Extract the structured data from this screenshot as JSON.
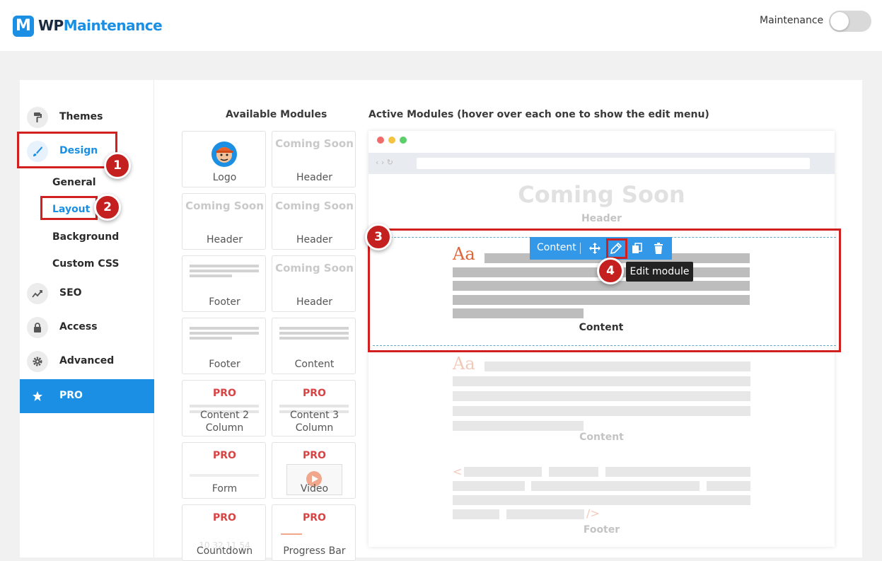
{
  "header": {
    "logo_letter": "M",
    "logo_wp": "WP",
    "logo_main": "Maintenance",
    "maintenance_label": "Maintenance",
    "maintenance_on": false
  },
  "sidebar": {
    "items": [
      {
        "label": "Themes",
        "icon": "paint-roller-icon"
      },
      {
        "label": "Design",
        "icon": "brush-icon"
      },
      {
        "label": "SEO",
        "icon": "chart-line-icon"
      },
      {
        "label": "Access",
        "icon": "lock-icon"
      },
      {
        "label": "Advanced",
        "icon": "gear-icon"
      },
      {
        "label": "PRO",
        "icon": "star-icon"
      }
    ],
    "design_subitems": [
      "General",
      "Layout",
      "Background",
      "Custom CSS"
    ]
  },
  "annotations": [
    "1",
    "2",
    "3",
    "4"
  ],
  "available_modules": {
    "title": "Available Modules",
    "coming_soon_text": "Coming Soon",
    "pro_tag": "PRO",
    "tiles": [
      {
        "label": "Logo"
      },
      {
        "label": "Header"
      },
      {
        "label": "Header"
      },
      {
        "label": "Header"
      },
      {
        "label": "Footer"
      },
      {
        "label": "Header"
      },
      {
        "label": "Footer"
      },
      {
        "label": "Content"
      },
      {
        "label": "Content 2 Column"
      },
      {
        "label": "Content 3 Column"
      },
      {
        "label": "Form"
      },
      {
        "label": "Video"
      },
      {
        "label": "Countdown"
      },
      {
        "label": "Progress Bar"
      }
    ],
    "countdown_digits": "10 32 11 54"
  },
  "active_modules": {
    "title": "Active Modules (hover over each one to show the edit menu)",
    "header_preview_text": "Coming Soon",
    "header_label": "Header",
    "content_aa": "Aa",
    "content_label": "Content",
    "content2_label": "Content",
    "footer_label": "Footer",
    "footer_lt": "<",
    "footer_slash": "/>",
    "toolbar": {
      "label": "Content",
      "icons": [
        "move-icon",
        "pencil-icon",
        "copy-icon",
        "trash-icon"
      ]
    },
    "tooltip": "Edit module"
  },
  "colors": {
    "accent": "#1a8fe3",
    "annotation_red": "#d0201f",
    "pro_red": "#d84444",
    "aa_orange": "#e0653a"
  }
}
